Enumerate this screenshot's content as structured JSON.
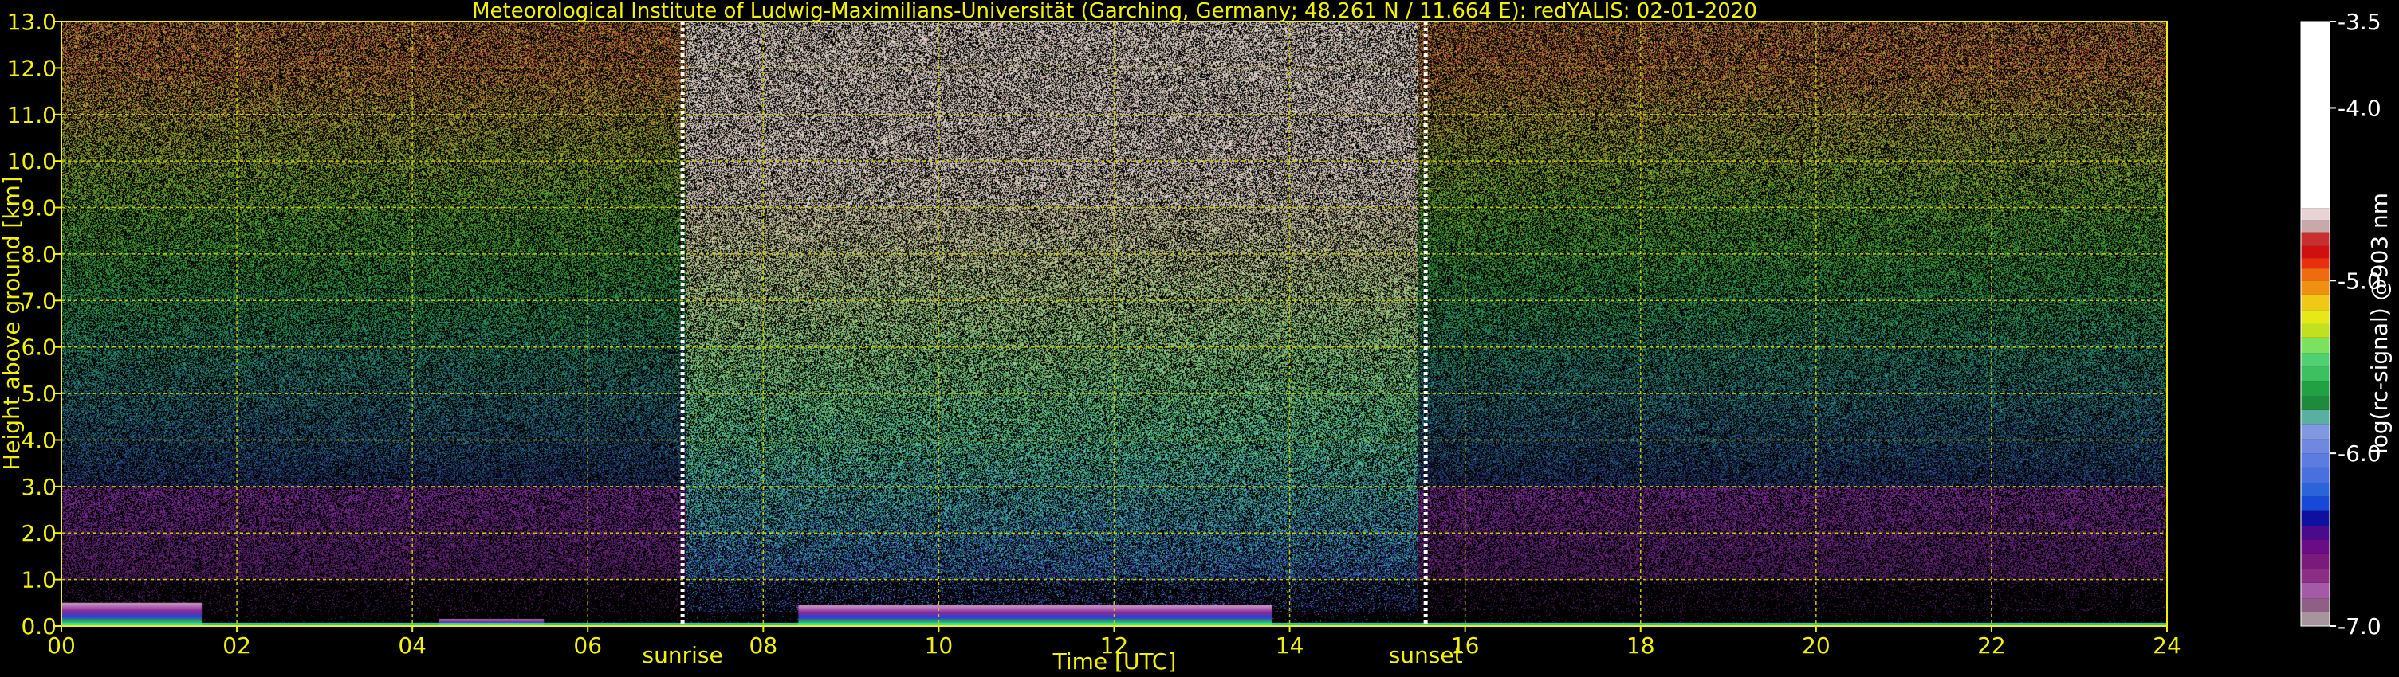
{
  "chart_data": {
    "type": "heatmap",
    "title": "Meteorological Institute of Ludwig-Maximilians-Universität (Garching, Germany; 48.261 N / 11.664 E):    redYALIS: 02-01-2020",
    "xlabel": "Time [UTC]",
    "ylabel": "Height above ground [km]",
    "xlim": [
      0,
      24
    ],
    "ylim": [
      0,
      13
    ],
    "x_ticks": [
      0,
      2,
      4,
      6,
      8,
      10,
      12,
      14,
      16,
      18,
      20,
      22,
      24
    ],
    "x_tick_labels": [
      "00",
      "02",
      "04",
      "06",
      "08",
      "10",
      "12",
      "14",
      "16",
      "18",
      "20",
      "22",
      "24"
    ],
    "y_ticks": [
      0,
      1,
      2,
      3,
      4,
      5,
      6,
      7,
      8,
      9,
      10,
      11,
      12,
      13
    ],
    "y_tick_labels": [
      "0.0",
      "1.0",
      "2.0",
      "3.0",
      "4.0",
      "5.0",
      "6.0",
      "7.0",
      "8.0",
      "9.0",
      "10.0",
      "11.0",
      "12.0",
      "13.0"
    ],
    "grid": true,
    "annotations": [
      {
        "label": "sunrise",
        "x": 7.08
      },
      {
        "label": "sunset",
        "x": 15.55
      }
    ],
    "colorbar": {
      "label": "log(rc-signal) @903 nm",
      "range": [
        -7.0,
        -3.5
      ],
      "tick_values": [
        -3.5,
        -4.0,
        -5.0,
        -6.0,
        -7.0
      ],
      "tick_labels": [
        "-3.5",
        "-4.0",
        "-5.0",
        "-6.0",
        "-7.0"
      ],
      "colors": [
        "#a7959d",
        "#8f5f86",
        "#a45aa7",
        "#8a2f85",
        "#7a1a7a",
        "#6a0c86",
        "#4b0a8c",
        "#1010a0",
        "#1848d8",
        "#2a64d8",
        "#4a70e0",
        "#5c7ce0",
        "#7088e0",
        "#8098e0",
        "#5ab0a0",
        "#1e8a3c",
        "#22a044",
        "#3cc060",
        "#50d070",
        "#7ce060",
        "#c0e020",
        "#e8e818",
        "#f0c818",
        "#f09010",
        "#f06a10",
        "#e83010",
        "#d01010",
        "#c83030",
        "#c8a8a8",
        "#e8d4d4",
        "#ffffff"
      ],
      "color_stops": [
        -7.0,
        -6.92,
        -6.84,
        -6.75,
        -6.67,
        -6.58,
        -6.5,
        -6.42,
        -6.33,
        -6.25,
        -6.17,
        -6.08,
        -6.0,
        -5.92,
        -5.83,
        -5.75,
        -5.67,
        -5.58,
        -5.5,
        -5.42,
        -5.33,
        -5.25,
        -5.17,
        -5.08,
        -5.0,
        -4.93,
        -4.87,
        -4.8,
        -4.72,
        -4.65,
        -4.58
      ]
    },
    "boundary_layer_segments": [
      {
        "x0": 0.0,
        "x1": 1.6,
        "top": 0.5
      },
      {
        "x0": 8.4,
        "x1": 13.8,
        "top": 0.45
      },
      {
        "x0": 4.3,
        "x1": 5.5,
        "top": 0.15
      }
    ],
    "colors": {
      "text": "#f2f200",
      "grid": "#c8c800",
      "background": "#000000",
      "dotted_lines": "#ffffff"
    }
  }
}
